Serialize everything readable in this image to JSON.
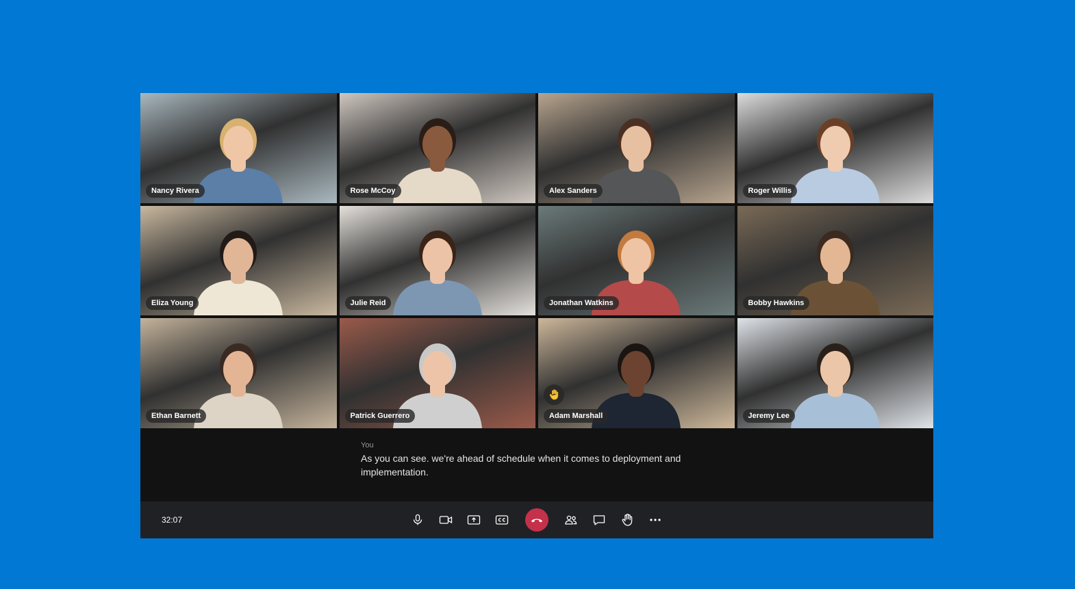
{
  "participants": [
    {
      "name": "Nancy Rivera",
      "bg": "#a9b8bf",
      "shirt": "#5b7fa6",
      "hair": "#d8b070",
      "skin": "#efc7a6"
    },
    {
      "name": "Rose McCoy",
      "bg": "#cfc7c0",
      "shirt": "#e5d9c8",
      "hair": "#2a1d17",
      "skin": "#8a5a3e"
    },
    {
      "name": "Alex Sanders",
      "bg": "#b7a48e",
      "shirt": "#555657",
      "hair": "#4a2f22",
      "skin": "#e7bfa1"
    },
    {
      "name": "Roger Willis",
      "bg": "#dcdcdc",
      "shirt": "#b8cbe0",
      "hair": "#6a3f26",
      "skin": "#efcbb0"
    },
    {
      "name": "Eliza Young",
      "bg": "#c9b89f",
      "shirt": "#efe7d6",
      "hair": "#221a16",
      "skin": "#e0b696"
    },
    {
      "name": "Julie Reid",
      "bg": "#e4e0db",
      "shirt": "#7d97b3",
      "hair": "#3a2418",
      "skin": "#ecc3a6"
    },
    {
      "name": "Jonathan Watkins",
      "bg": "#6b7a7a",
      "shirt": "#b54a4a",
      "hair": "#c27a3e",
      "skin": "#efc4a4"
    },
    {
      "name": "Bobby Hawkins",
      "bg": "#7a6a56",
      "shirt": "#6b5237",
      "hair": "#3b2a20",
      "skin": "#e3b694"
    },
    {
      "name": "Ethan Barnett",
      "bg": "#c4b39b",
      "shirt": "#ddd4c6",
      "hair": "#3a2a22",
      "skin": "#e3b594"
    },
    {
      "name": "Patrick Guerrero",
      "bg": "#9a5a4a",
      "shirt": "#cfcfcf",
      "hair": "#c8c8c8",
      "skin": "#edc4a8"
    },
    {
      "name": "Adam Marshall",
      "bg": "#cdb79a",
      "shirt": "#1e2533",
      "hair": "#1a1412",
      "skin": "#6b4330",
      "hand_raised": true
    },
    {
      "name": "Jeremy Lee",
      "bg": "#dfe3e8",
      "shirt": "#a8bfd8",
      "hair": "#2a201a",
      "skin": "#ecc6a8"
    }
  ],
  "caption": {
    "speaker": "You",
    "text": "As you can see. we're ahead of schedule when it comes to deployment and implementation."
  },
  "controls": {
    "timer": "32:07",
    "buttons": [
      "mic-icon",
      "camera-icon",
      "share-screen-icon",
      "captions-icon",
      "end-call-icon",
      "participants-icon",
      "chat-icon",
      "raise-hand-icon",
      "more-icon"
    ],
    "end_call_color": "#c4314b"
  },
  "colors": {
    "background": "#0078d4",
    "window": "#121212",
    "control_bar": "#202124"
  }
}
